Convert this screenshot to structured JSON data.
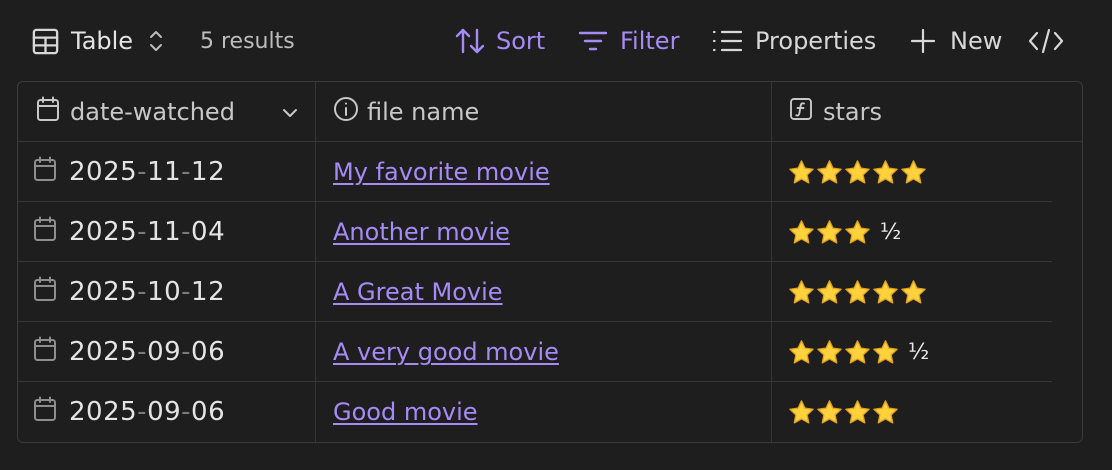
{
  "toolbar": {
    "view_label": "Table",
    "results": "5 results",
    "sort_label": "Sort",
    "filter_label": "Filter",
    "properties_label": "Properties",
    "new_label": "New"
  },
  "columns": [
    "date-watched",
    "file name",
    "stars"
  ],
  "rows": [
    {
      "y": "2025",
      "m": "11",
      "d": "12",
      "title": "My favorite movie",
      "stars": 5,
      "half": ""
    },
    {
      "y": "2025",
      "m": "11",
      "d": "04",
      "title": "Another movie",
      "stars": 3,
      "half": "½"
    },
    {
      "y": "2025",
      "m": "10",
      "d": "12",
      "title": "A Great Movie",
      "stars": 5,
      "half": ""
    },
    {
      "y": "2025",
      "m": "09",
      "d": "06",
      "title": "A very good movie",
      "stars": 4,
      "half": "½"
    },
    {
      "y": "2025",
      "m": "09",
      "d": "06",
      "title": "Good movie",
      "stars": 4,
      "half": ""
    }
  ],
  "colors": {
    "accent": "#a68bf6",
    "background": "#1e1e1e",
    "star_fill": "#ffd23d",
    "star_edge": "#e0a21b"
  },
  "icons": [
    "table-icon",
    "chevron-updown-icon",
    "sort-icon",
    "filter-icon",
    "list-icon",
    "plus-icon",
    "code-icon",
    "calendar-icon",
    "info-icon",
    "formula-icon",
    "chevron-down-icon",
    "star-icon"
  ]
}
